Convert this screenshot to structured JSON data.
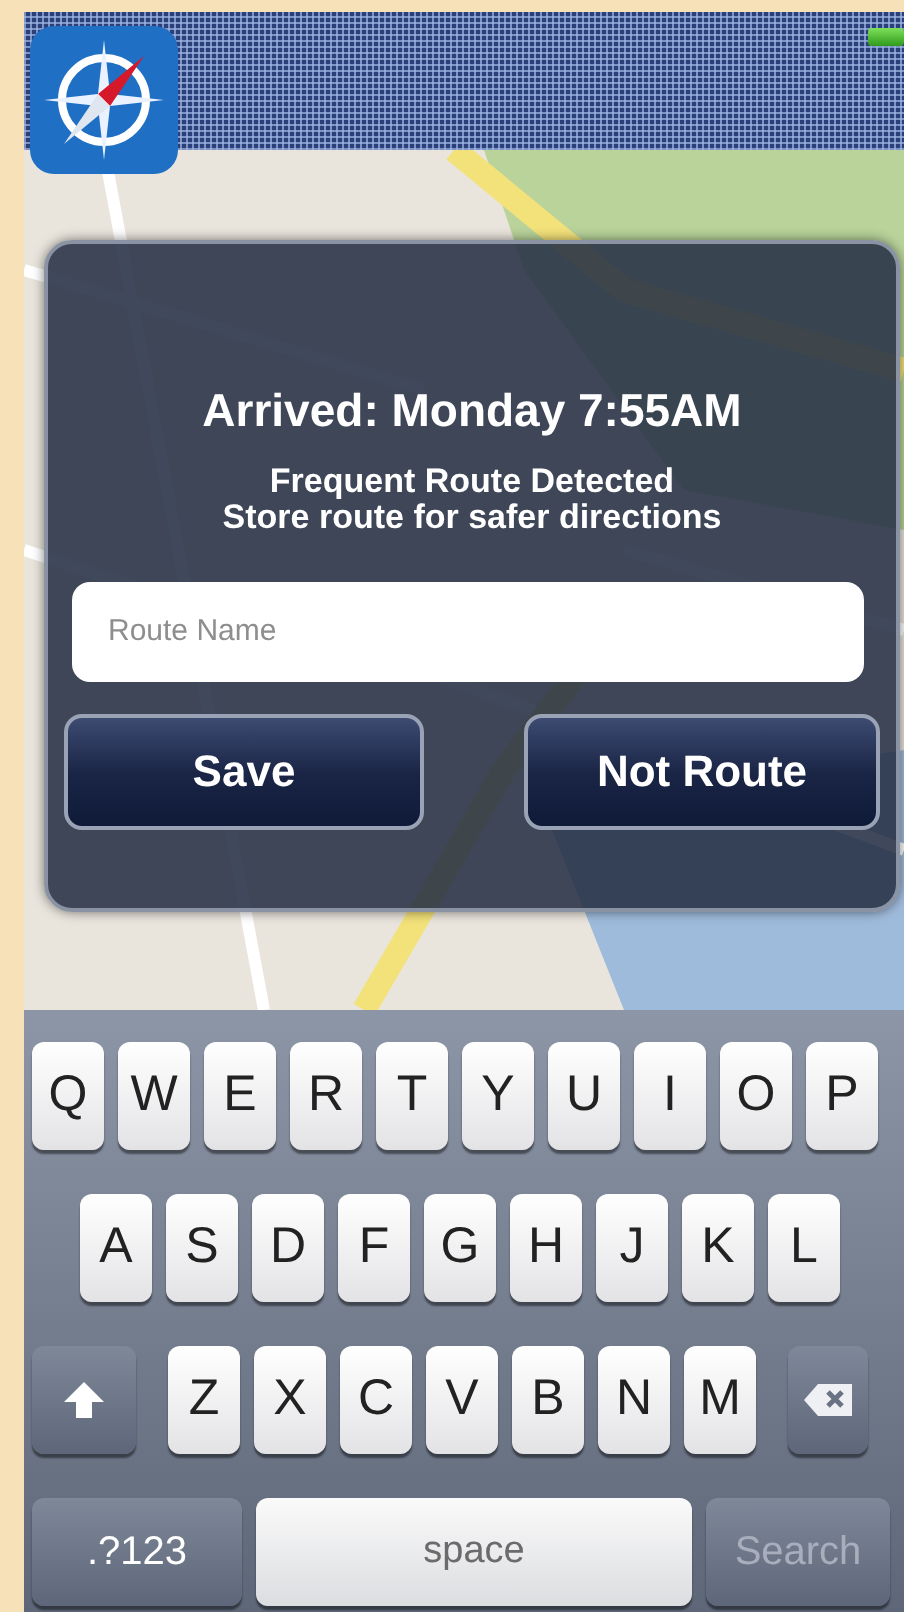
{
  "dialog": {
    "title": "Arrived: Monday 7:55AM",
    "message_lines": [
      "Frequent Route Detected",
      "Store route for safer directions"
    ],
    "route_name": {
      "placeholder": "Route Name"
    },
    "buttons": [
      "Save",
      "Not Route"
    ]
  },
  "keyboard": {
    "rows": [
      {
        "keys": [
          {
            "kind": "letter",
            "label": "Q"
          },
          {
            "kind": "letter",
            "label": "W"
          },
          {
            "kind": "letter",
            "label": "E"
          },
          {
            "kind": "letter",
            "label": "R"
          },
          {
            "kind": "letter",
            "label": "T"
          },
          {
            "kind": "letter",
            "label": "Y"
          },
          {
            "kind": "letter",
            "label": "U"
          },
          {
            "kind": "letter",
            "label": "I"
          },
          {
            "kind": "letter",
            "label": "O"
          },
          {
            "kind": "letter",
            "label": "P"
          }
        ]
      },
      {
        "keys": [
          {
            "kind": "letter",
            "label": "A"
          },
          {
            "kind": "letter",
            "label": "S"
          },
          {
            "kind": "letter",
            "label": "D"
          },
          {
            "kind": "letter",
            "label": "F"
          },
          {
            "kind": "letter",
            "label": "G"
          },
          {
            "kind": "letter",
            "label": "H"
          },
          {
            "kind": "letter",
            "label": "J"
          },
          {
            "kind": "letter",
            "label": "K"
          },
          {
            "kind": "letter",
            "label": "L"
          }
        ]
      },
      {
        "keys": [
          {
            "kind": "shift"
          },
          {
            "kind": "letter",
            "label": "Z"
          },
          {
            "kind": "letter",
            "label": "X"
          },
          {
            "kind": "letter",
            "label": "C"
          },
          {
            "kind": "letter",
            "label": "V"
          },
          {
            "kind": "letter",
            "label": "B"
          },
          {
            "kind": "letter",
            "label": "N"
          },
          {
            "kind": "letter",
            "label": "M"
          },
          {
            "kind": "delete"
          }
        ]
      },
      {
        "keys": [
          {
            "kind": "mode",
            "label": ".?123"
          },
          {
            "kind": "space",
            "label": "space"
          },
          {
            "kind": "action",
            "label": "Search",
            "disabled": true
          }
        ]
      }
    ]
  }
}
